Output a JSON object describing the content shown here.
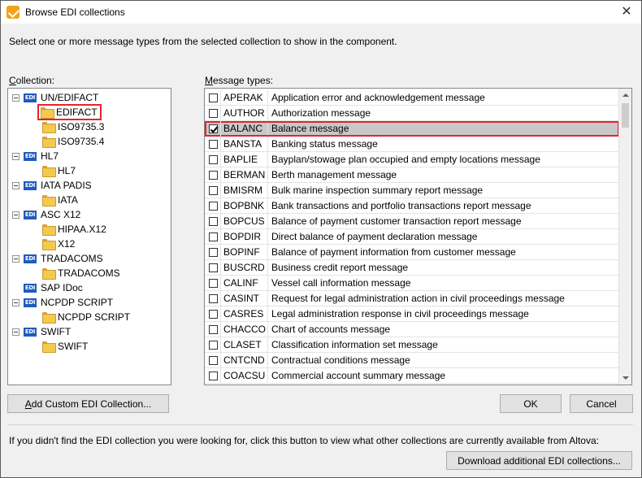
{
  "window": {
    "title": "Browse EDI collections",
    "close_label": "✕"
  },
  "instruction": "Select one or more message types from the selected collection to show in the component.",
  "collection_label": {
    "accel": "C",
    "rest": "ollection:"
  },
  "messages_label": {
    "accel": "M",
    "rest": "essage types:"
  },
  "tree": [
    {
      "label": "UN/EDIFACT",
      "type": "edi",
      "expanded": true
    },
    {
      "label": "EDIFACT",
      "type": "folder",
      "selected": true
    },
    {
      "label": "ISO9735.3",
      "type": "folder"
    },
    {
      "label": "ISO9735.4",
      "type": "folder"
    },
    {
      "label": "HL7",
      "type": "edi",
      "expanded": true
    },
    {
      "label": "HL7",
      "type": "folder"
    },
    {
      "label": "IATA PADIS",
      "type": "edi",
      "expanded": true
    },
    {
      "label": "IATA",
      "type": "folder"
    },
    {
      "label": "ASC X12",
      "type": "edi",
      "expanded": true
    },
    {
      "label": "HIPAA.X12",
      "type": "folder"
    },
    {
      "label": "X12",
      "type": "folder"
    },
    {
      "label": "TRADACOMS",
      "type": "edi",
      "expanded": true
    },
    {
      "label": "TRADACOMS",
      "type": "folder"
    },
    {
      "label": "SAP IDoc",
      "type": "edi",
      "expanded": false
    },
    {
      "label": "NCPDP SCRIPT",
      "type": "edi",
      "expanded": true
    },
    {
      "label": "NCPDP SCRIPT",
      "type": "folder"
    },
    {
      "label": "SWIFT",
      "type": "edi",
      "expanded": true
    },
    {
      "label": "SWIFT",
      "type": "folder"
    }
  ],
  "edi_icon_text": "EDI",
  "messages": [
    {
      "code": "APERAK",
      "desc": "Application error and acknowledgement message",
      "checked": false
    },
    {
      "code": "AUTHOR",
      "desc": "Authorization message",
      "checked": false
    },
    {
      "code": "BALANC",
      "desc": "Balance message",
      "checked": true,
      "selected": true
    },
    {
      "code": "BANSTA",
      "desc": "Banking status message",
      "checked": false
    },
    {
      "code": "BAPLIE",
      "desc": "Bayplan/stowage plan occupied and empty locations message",
      "checked": false
    },
    {
      "code": "BERMAN",
      "desc": "Berth management message",
      "checked": false
    },
    {
      "code": "BMISRM",
      "desc": "Bulk marine inspection summary report message",
      "checked": false
    },
    {
      "code": "BOPBNK",
      "desc": "Bank transactions and portfolio transactions report message",
      "checked": false
    },
    {
      "code": "BOPCUS",
      "desc": "Balance of payment customer transaction report message",
      "checked": false
    },
    {
      "code": "BOPDIR",
      "desc": "Direct balance of payment declaration message",
      "checked": false
    },
    {
      "code": "BOPINF",
      "desc": "Balance of payment information from customer message",
      "checked": false
    },
    {
      "code": "BUSCRD",
      "desc": "Business credit report message",
      "checked": false
    },
    {
      "code": "CALINF",
      "desc": "Vessel call information message",
      "checked": false
    },
    {
      "code": "CASINT",
      "desc": "Request for legal administration action in civil proceedings message",
      "checked": false
    },
    {
      "code": "CASRES",
      "desc": "Legal administration response in civil proceedings message",
      "checked": false
    },
    {
      "code": "CHACCO",
      "desc": "Chart of accounts message",
      "checked": false
    },
    {
      "code": "CLASET",
      "desc": "Classification information set message",
      "checked": false
    },
    {
      "code": "CNTCND",
      "desc": "Contractual conditions message",
      "checked": false
    },
    {
      "code": "COACSU",
      "desc": "Commercial account summary message",
      "checked": false
    }
  ],
  "buttons": {
    "add_collection": {
      "accel": "A",
      "rest": "dd Custom EDI Collection..."
    },
    "ok": "OK",
    "cancel": "Cancel",
    "download": "Download additional EDI collections..."
  },
  "footer_text": "If you didn't find the EDI collection you were looking for, click this button to view what other collections are currently available from Altova:"
}
